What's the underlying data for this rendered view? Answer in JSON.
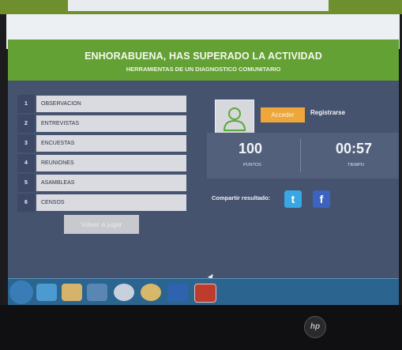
{
  "banner": {
    "title": "ENHORABUENA, HAS SUPERADO LA ACTIVIDAD",
    "subtitle": "HERRAMIENTAS DE UN DIAGNOSTICO COMUNITARIO"
  },
  "activities": [
    {
      "num": "1",
      "label": "OBSERVACION"
    },
    {
      "num": "2",
      "label": "ENTREVISTAS"
    },
    {
      "num": "3",
      "label": "ENCUESTAS"
    },
    {
      "num": "4",
      "label": "REUNIONES"
    },
    {
      "num": "5",
      "label": "ASAMBLEAS"
    },
    {
      "num": "6",
      "label": "CENSOS"
    }
  ],
  "replay_label": "Volver a jugar",
  "auth": {
    "login_label": "Acceder",
    "register_label": "Registrarse"
  },
  "score": {
    "points": "100",
    "points_label": "PUNTOS",
    "time": "00:57",
    "time_label": "TIEMPO"
  },
  "share": {
    "label": "Compartir resultado:",
    "twitter_glyph": "t",
    "facebook_glyph": "f"
  },
  "taskbar_icons": [
    "windows-start-icon",
    "ie-icon",
    "folder-icon",
    "media-player-icon",
    "chrome-icon",
    "app-icon",
    "word-icon",
    "acrobat-icon"
  ],
  "brand": "hp",
  "colors": {
    "banner": "#63a134",
    "panel": "#46536f",
    "accent": "#efa63a",
    "twitter": "#38a7e3",
    "facebook": "#3c63c0"
  }
}
